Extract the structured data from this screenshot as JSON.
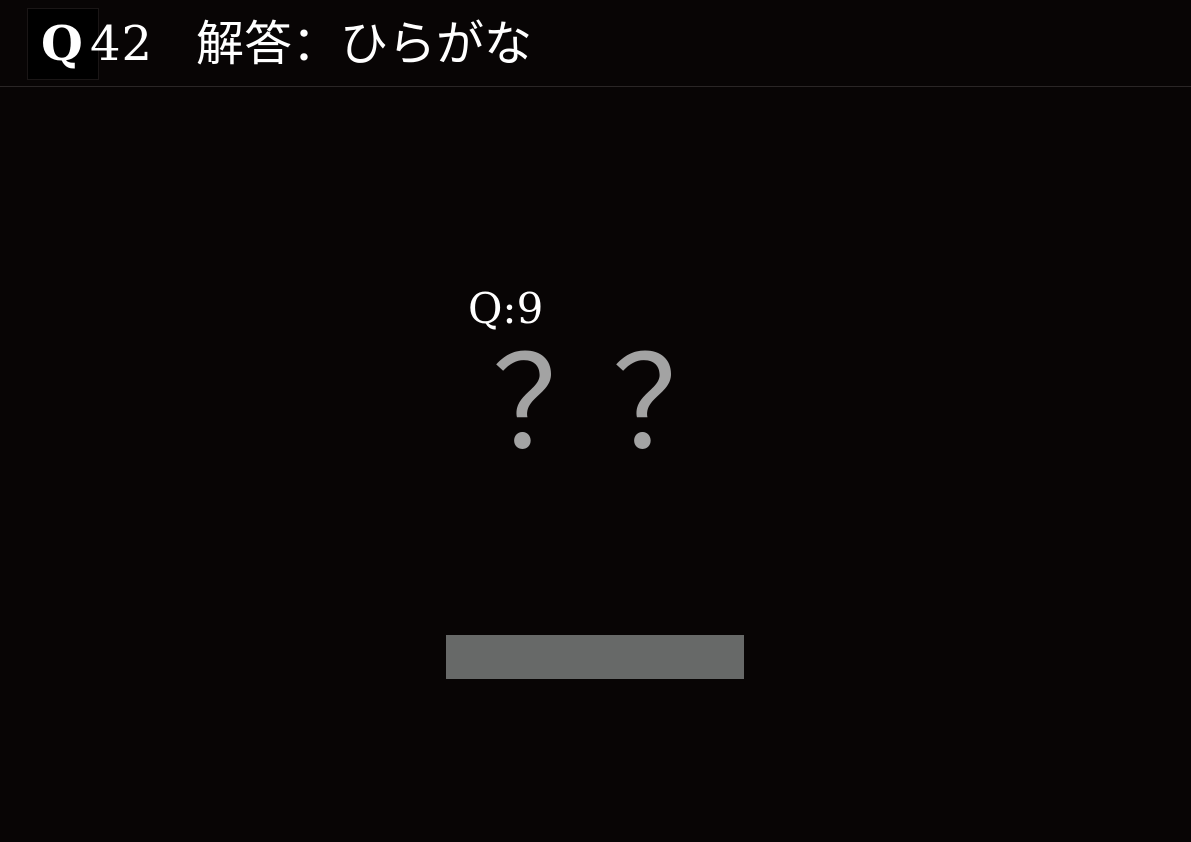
{
  "header": {
    "badge_letter": "Q",
    "question_number": "42",
    "title": "解答：ひらがな"
  },
  "puzzle": {
    "label": "Q:9",
    "hidden_chars": [
      "？",
      "？"
    ]
  },
  "answer_input": {
    "value": "",
    "placeholder": ""
  },
  "colors": {
    "background": "#080505",
    "text": "#ffffff",
    "mystery_text": "#a3a3a3",
    "input_background": "#676968"
  }
}
